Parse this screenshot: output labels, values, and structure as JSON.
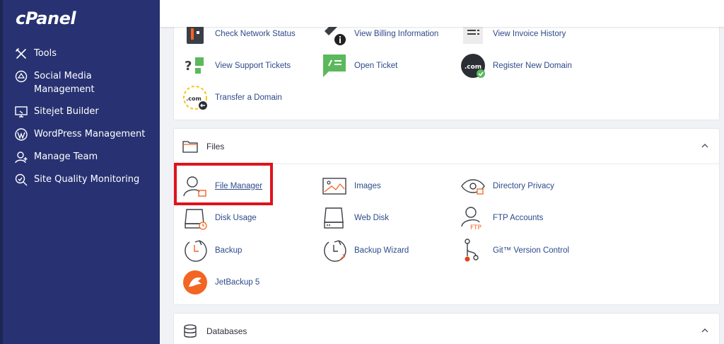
{
  "brand": {
    "logo_text": "cPanel"
  },
  "sidebar": {
    "items": [
      {
        "label": "Tools",
        "icon": "tools-icon"
      },
      {
        "label": "Social Media\nManagement",
        "icon": "social-media-icon"
      },
      {
        "label": "Sitejet Builder",
        "icon": "sitejet-icon"
      },
      {
        "label": "WordPress Management",
        "icon": "wordpress-icon"
      },
      {
        "label": "Manage Team",
        "icon": "manage-team-icon"
      },
      {
        "label": "Site Quality Monitoring",
        "icon": "site-quality-icon"
      }
    ]
  },
  "billing_section": {
    "items": [
      {
        "label": "Check Network Status",
        "icon": "network-status-icon"
      },
      {
        "label": "View Billing Information",
        "icon": "billing-info-icon"
      },
      {
        "label": "View Invoice History",
        "icon": "invoice-history-icon"
      },
      {
        "label": "View Support Tickets",
        "icon": "support-tickets-icon"
      },
      {
        "label": "Open Ticket",
        "icon": "open-ticket-icon"
      },
      {
        "label": "Register New Domain",
        "icon": "register-domain-icon"
      },
      {
        "label": "Transfer a Domain",
        "icon": "transfer-domain-icon"
      }
    ]
  },
  "files_section": {
    "title": "Files",
    "items": [
      {
        "label": "File Manager",
        "icon": "file-manager-icon",
        "highlighted": true
      },
      {
        "label": "Images",
        "icon": "images-icon"
      },
      {
        "label": "Directory Privacy",
        "icon": "directory-privacy-icon"
      },
      {
        "label": "Disk Usage",
        "icon": "disk-usage-icon"
      },
      {
        "label": "Web Disk",
        "icon": "web-disk-icon"
      },
      {
        "label": "FTP Accounts",
        "icon": "ftp-accounts-icon"
      },
      {
        "label": "Backup",
        "icon": "backup-icon"
      },
      {
        "label": "Backup Wizard",
        "icon": "backup-wizard-icon"
      },
      {
        "label": "Git™ Version Control",
        "icon": "git-icon"
      },
      {
        "label": "JetBackup 5",
        "icon": "jetbackup-icon"
      }
    ]
  },
  "databases_section": {
    "title": "Databases"
  },
  "icon_text": {
    "com": ".com",
    "ftp": "FTP"
  },
  "colors": {
    "sidebar_bg": "#283272",
    "accent_orange": "#f26522",
    "icon_green": "#5cb85c",
    "link_blue": "#2e4a8a",
    "highlight_red": "#e0131b"
  }
}
